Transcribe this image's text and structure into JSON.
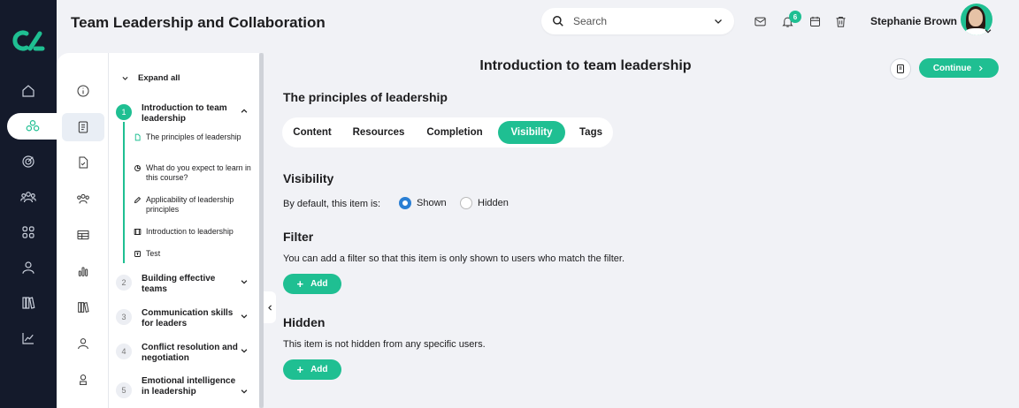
{
  "header": {
    "title": "Team Leadership and Collaboration",
    "search_placeholder": "Search",
    "notification_count": "6",
    "user_name": "Stephanie Brown"
  },
  "rail": {
    "items": [
      "home",
      "groups",
      "target",
      "people",
      "grid",
      "person",
      "library",
      "analytics"
    ],
    "active": "groups"
  },
  "outline": {
    "expand_all": "Expand all",
    "chapters": [
      {
        "num": "1",
        "title": "Introduction to team leadership",
        "expanded": true,
        "lessons": [
          {
            "icon": "document-icon",
            "label": "The principles of leadership",
            "active": true
          },
          {
            "icon": "pie-icon",
            "label": "What do you expect to learn in this course?"
          },
          {
            "icon": "pencil-icon",
            "label": "Applicability of leadership principles"
          },
          {
            "icon": "video-icon",
            "label": "Introduction to leadership"
          },
          {
            "icon": "test-icon",
            "label": "Test"
          }
        ]
      },
      {
        "num": "2",
        "title": "Building effective teams"
      },
      {
        "num": "3",
        "title": "Communication skills for leaders"
      },
      {
        "num": "4",
        "title": "Conflict resolution and negotiation"
      },
      {
        "num": "5",
        "title": "Emotional intelligence in leadership"
      }
    ]
  },
  "main": {
    "lesson_title": "Introduction to team leadership",
    "continue_label": "Continue",
    "item_title": "The principles of leadership",
    "tabs": [
      "Content",
      "Resources",
      "Completion",
      "Visibility",
      "Tags"
    ],
    "active_tab": "Visibility",
    "visibility": {
      "heading": "Visibility",
      "default_label": "By default, this item is:",
      "options": [
        "Shown",
        "Hidden"
      ],
      "selected": "Shown"
    },
    "filter": {
      "heading": "Filter",
      "description": "You can add a filter so that this item is only shown to users who match the filter.",
      "add_label": "Add"
    },
    "hidden": {
      "heading": "Hidden",
      "description": "This item is not hidden from any specific users.",
      "add_label": "Add"
    }
  },
  "colors": {
    "accent": "#1fbf92",
    "rail": "#141a2b",
    "radio": "#2a7fd4",
    "background": "#f1f2f6"
  }
}
